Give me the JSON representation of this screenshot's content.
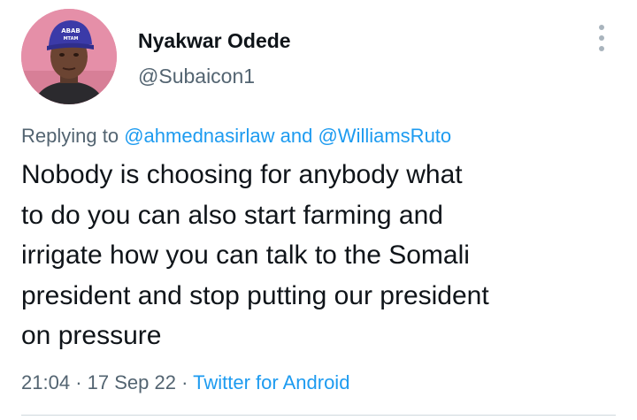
{
  "author": {
    "display_name": "Nyakwar Odede",
    "handle": "@Subaicon1"
  },
  "reply": {
    "prefix": "Replying to",
    "mention_1": "@ahmednasirlaw",
    "conjunction": "and",
    "mention_2": "@WilliamsRuto"
  },
  "tweet": {
    "lines": [
      "Nobody is choosing for anybody what",
      "to do you can also start farming and",
      "irrigate how you can talk to the Somali",
      "president and stop putting our president",
      "on pressure"
    ]
  },
  "meta": {
    "time": "21:04",
    "separator": "·",
    "date": "17 Sep 22",
    "source": "Twitter for Android"
  },
  "icons": {
    "more": "more-vertical-icon"
  },
  "colors": {
    "accent": "#1d9bf0",
    "text": "#0f1419",
    "secondary": "#536471"
  }
}
